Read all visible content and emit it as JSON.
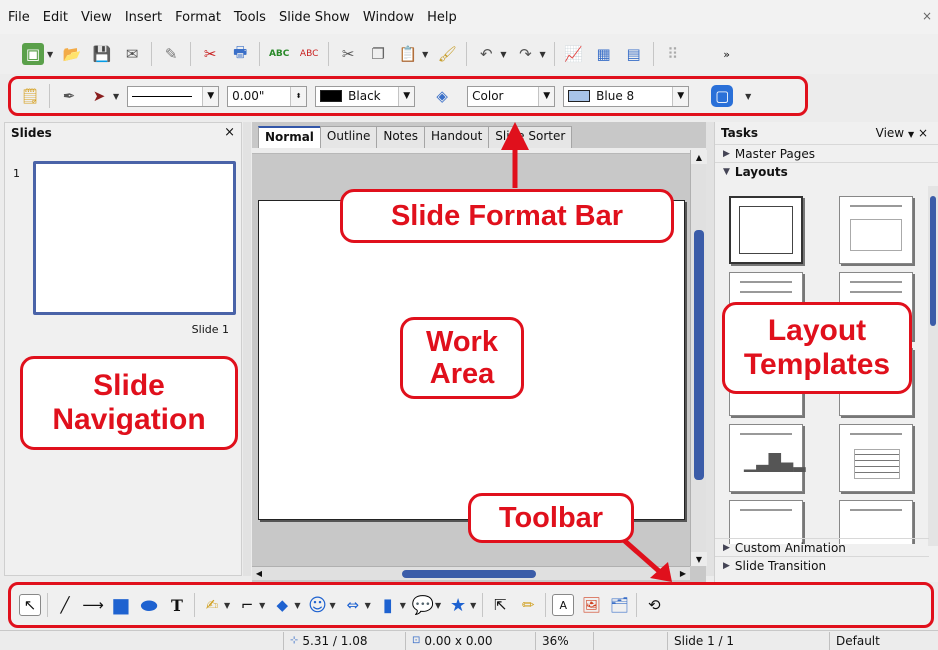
{
  "menu": {
    "items": [
      "File",
      "Edit",
      "View",
      "Insert",
      "Format",
      "Tools",
      "Slide Show",
      "Window",
      "Help"
    ],
    "close": "×"
  },
  "format_bar": {
    "line_width": "0.00\"",
    "line_color": "Black",
    "area_style": "Color",
    "fill_color": "Blue 8"
  },
  "slides_pane": {
    "title": "Slides",
    "close": "×",
    "slide_number": "1",
    "slide_caption": "Slide 1"
  },
  "view_tabs": [
    "Normal",
    "Outline",
    "Notes",
    "Handout",
    "Slide Sorter"
  ],
  "tasks_pane": {
    "title": "Tasks",
    "view_label": "View",
    "sections": [
      "Master Pages",
      "Layouts"
    ],
    "bottom_sections": [
      "Custom Animation",
      "Slide Transition"
    ]
  },
  "status_bar": {
    "position": "5.31 / 1.08",
    "size": "0.00 x 0.00",
    "zoom": "36%",
    "slide": "Slide 1 / 1",
    "master": "Default"
  },
  "annotations": {
    "slide_format_bar": "Slide Format Bar",
    "work_area": [
      "Work",
      "Area"
    ],
    "layout_templates": [
      "Layout",
      "Templates"
    ],
    "slide_navigation": [
      "Slide",
      "Navigation"
    ],
    "toolbar": "Toolbar"
  },
  "colors": {
    "annotation": "#e0101c",
    "accent": "#3b5ca8"
  }
}
